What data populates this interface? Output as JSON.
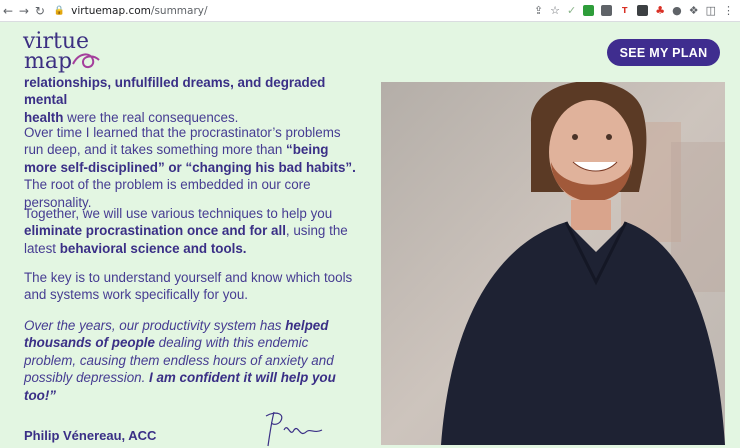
{
  "browser": {
    "url_host": "virtuemap.com",
    "url_path": "/summary/"
  },
  "header": {
    "logo_line1": "virtue",
    "logo_line2": "map",
    "cta_label": "SEE MY PLAN"
  },
  "content": {
    "p0": {
      "pre": "relationships, unfulfilled dreams, and degraded mental",
      "bold": "health",
      "post": " were the real consequences."
    },
    "p1": {
      "pre": "Over time I learned that the procrastinator’s problems run deep, and it takes something more than ",
      "bold": "“being more self-disciplined” or “changing his bad habits”.",
      "post": " The root of the problem is embedded in our core personality."
    },
    "p2": {
      "pre": "Together, we will use various techniques to help you ",
      "bold1": "eliminate procrastination once and for all",
      "mid": ", using the latest ",
      "bold2": "behavioral science and tools."
    },
    "p3": "The key is to understand yourself and know which tools and systems work specifically for you.",
    "p4": {
      "pre": "Over the years, our productivity system has ",
      "bold1": "helped thousands of people",
      "mid": " dealing with this endemic problem, causing them endless hours of anxiety and possibly depression. ",
      "bold2": "I am confident it will help you too!”"
    },
    "signer_name": "Philip Vénereau, ACC"
  },
  "colors": {
    "background": "#e3f6e2",
    "accent": "#3f2d8f",
    "text": "#463c92"
  }
}
